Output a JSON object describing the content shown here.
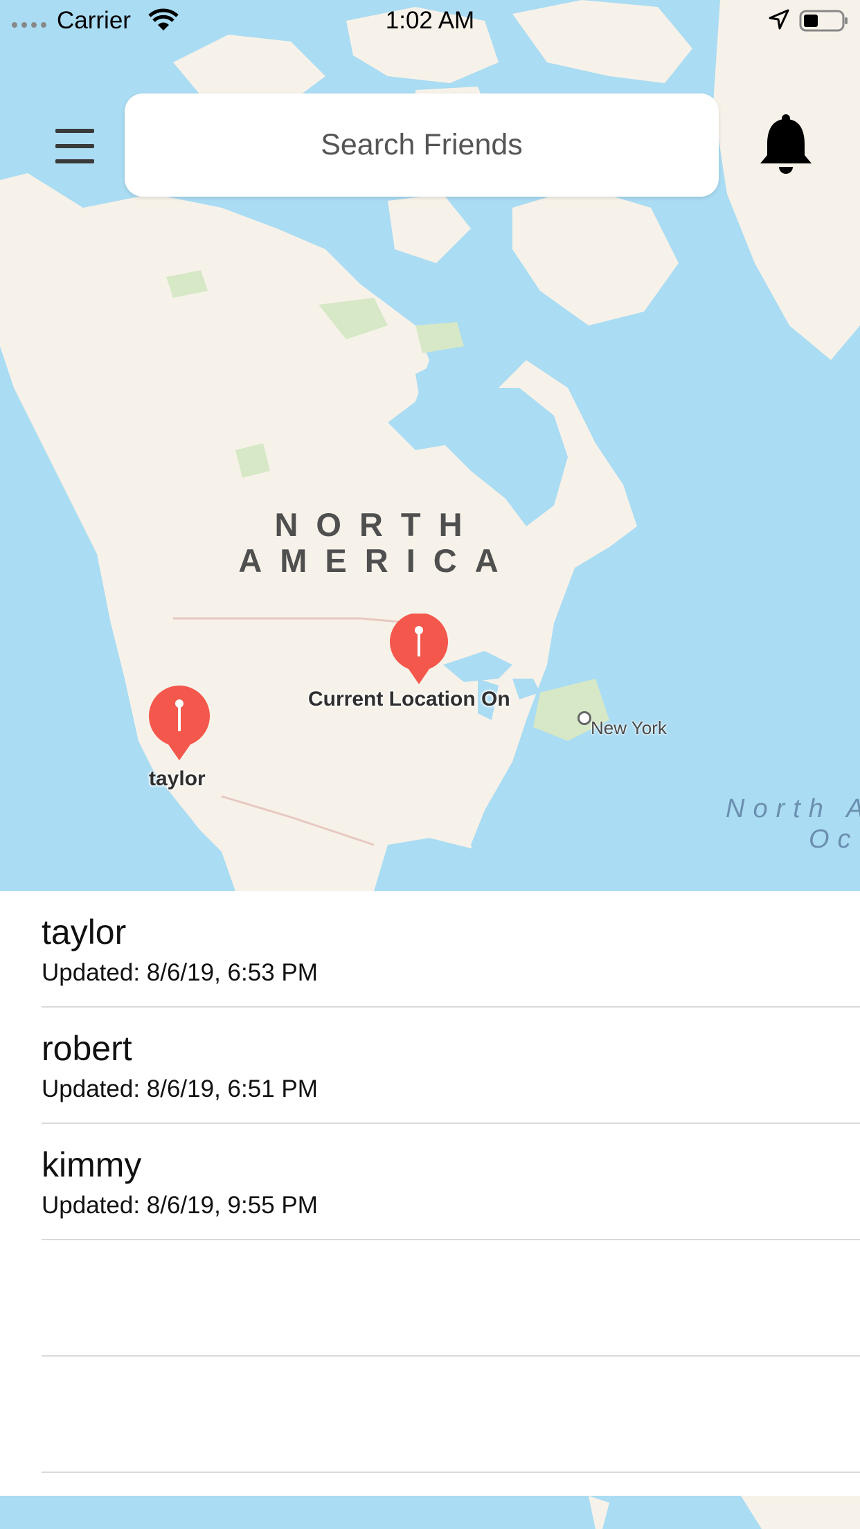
{
  "status_bar": {
    "carrier": "Carrier",
    "time": "1:02 AM"
  },
  "header": {
    "search_placeholder": "Search Friends",
    "menu_icon": "hamburger-menu-icon",
    "notification_icon": "bell-icon"
  },
  "map": {
    "continent_label_line1": "NORTH",
    "continent_label_line2": "AMERICA",
    "city_label": "New York",
    "ocean_label_line1": "North A",
    "ocean_label_line2": "Oc",
    "pins": [
      {
        "label": "Current Location On",
        "color": "#f4574b"
      },
      {
        "label": "taylor",
        "color": "#f4574b"
      }
    ],
    "colors": {
      "water": "#aadcf3",
      "land": "#f7f2e9",
      "park": "#d6e8c6"
    }
  },
  "friends": [
    {
      "name": "taylor",
      "updated": "Updated: 8/6/19, 6:53 PM"
    },
    {
      "name": "robert",
      "updated": "Updated: 8/6/19, 6:51 PM"
    },
    {
      "name": "kimmy",
      "updated": "Updated: 8/6/19, 9:55 PM"
    }
  ]
}
